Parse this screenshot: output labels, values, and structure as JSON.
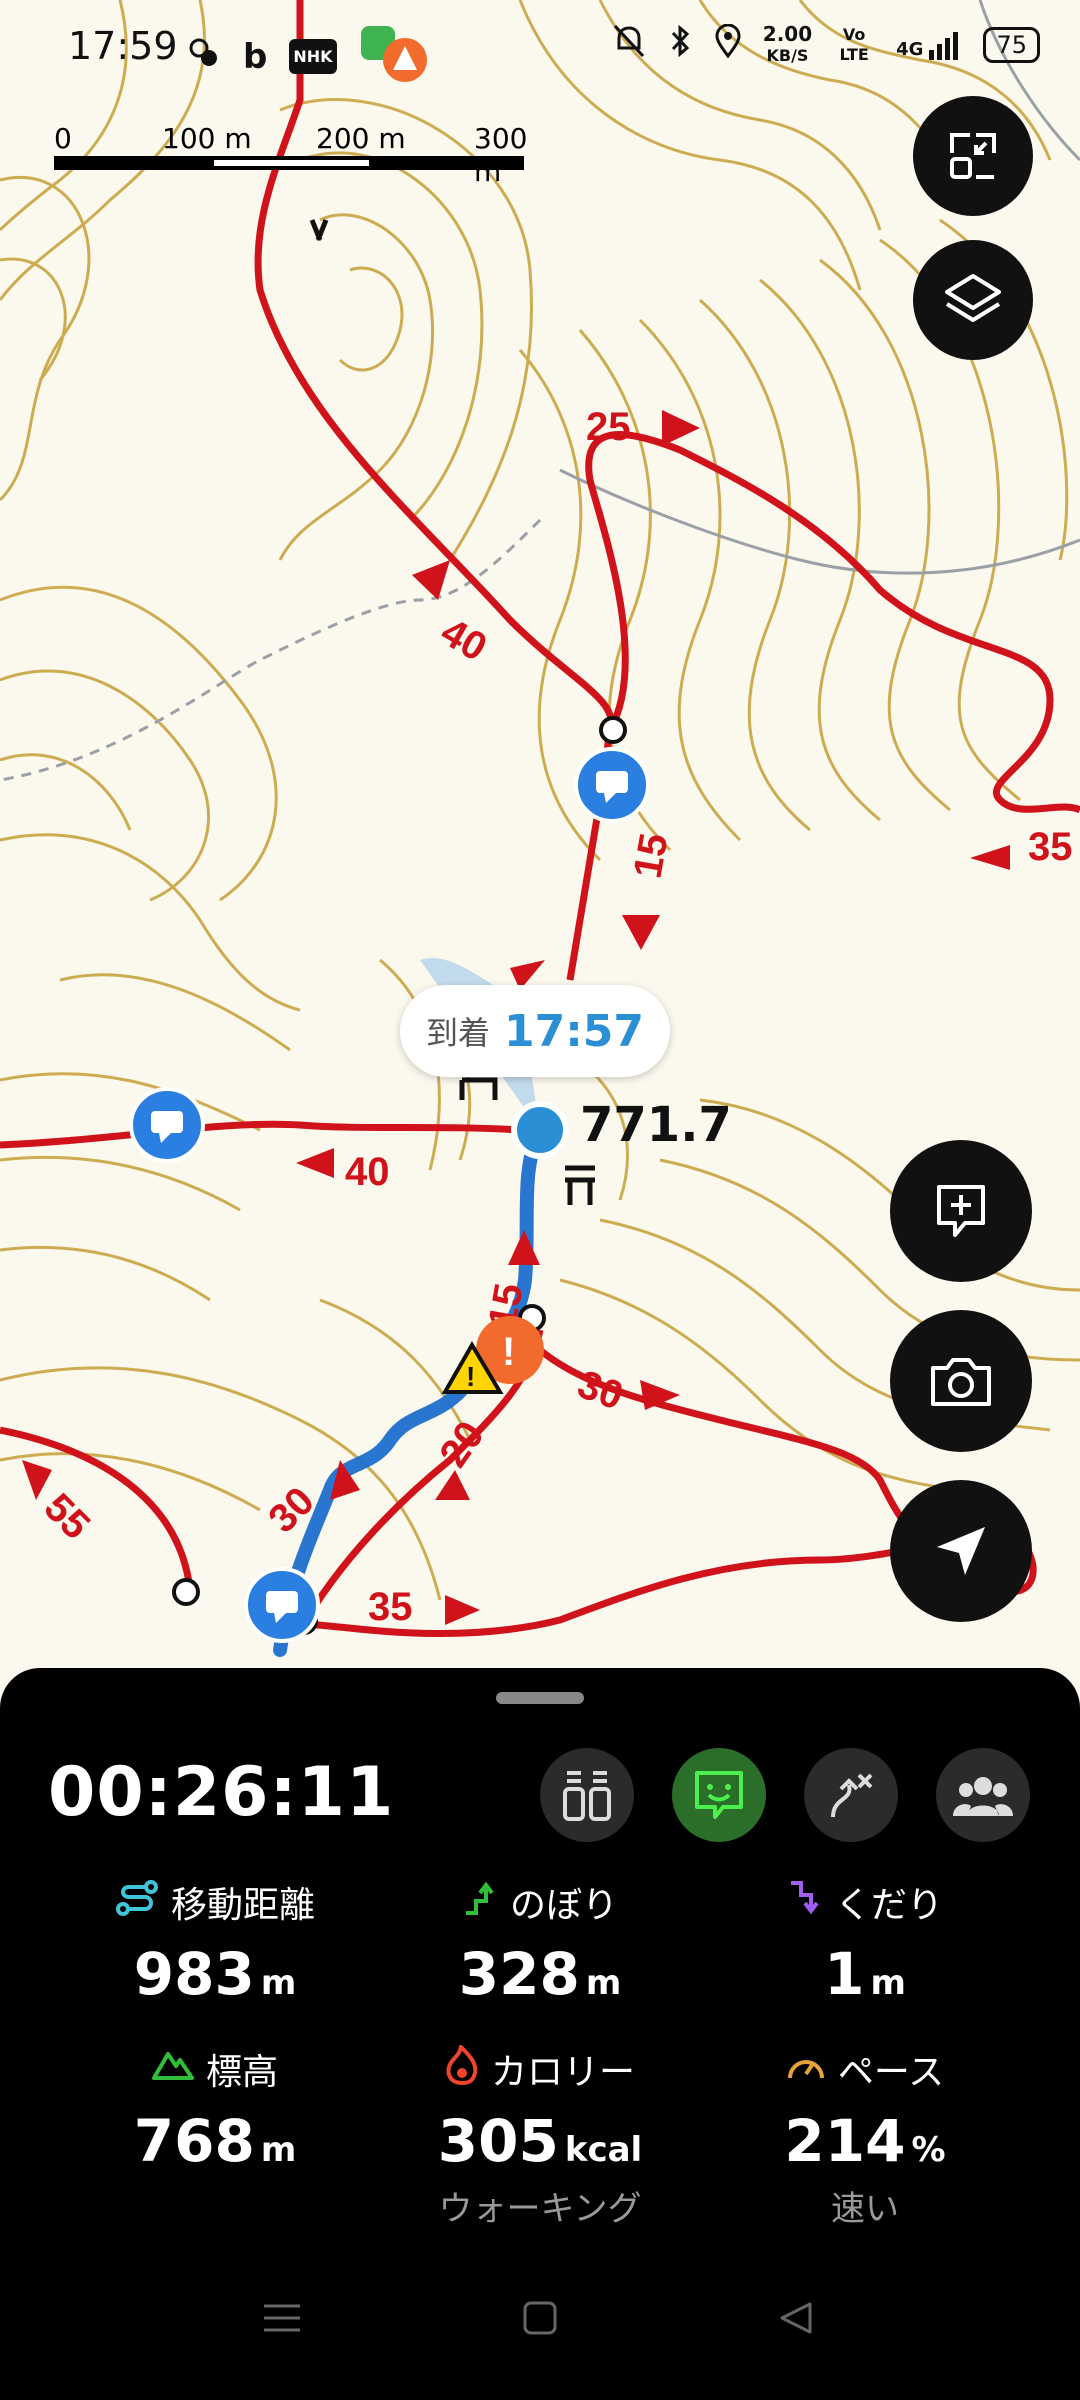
{
  "status_bar": {
    "time": "17:59",
    "speed_value": "2.00",
    "speed_unit": "KB/S",
    "volte": "Vo LTE",
    "network": "4G",
    "battery": "75"
  },
  "map": {
    "scale_labels": [
      "0",
      "100 m",
      "200 m",
      "300 m"
    ],
    "arrival_label": "到着",
    "arrival_time": "17:57",
    "current_elevation": "771.7",
    "route_labels": [
      "25",
      "40",
      "15",
      "35",
      "40",
      "15",
      "30",
      "20",
      "30",
      "55",
      "35"
    ]
  },
  "panel": {
    "elapsed_time": "00:26:11",
    "stats": [
      {
        "label": "移動距離",
        "value": "983",
        "unit": "m",
        "icon": "route-icon"
      },
      {
        "label": "のぼり",
        "value": "328",
        "unit": "m",
        "icon": "ascent-icon"
      },
      {
        "label": "くだり",
        "value": "1",
        "unit": "m",
        "icon": "descent-icon"
      },
      {
        "label": "標高",
        "value": "768",
        "unit": "m",
        "icon": "mountain-icon"
      },
      {
        "label": "カロリー",
        "value": "305",
        "unit": "kcal",
        "sub": "ウォーキング",
        "icon": "flame-icon"
      },
      {
        "label": "ペース",
        "value": "214",
        "unit": "%",
        "sub": "速い",
        "icon": "speedometer-icon"
      }
    ]
  },
  "colors": {
    "contour": "#c9a441",
    "route": "#d0121b",
    "track": "#2b8fd6",
    "accent_green": "#2fbf3a"
  }
}
